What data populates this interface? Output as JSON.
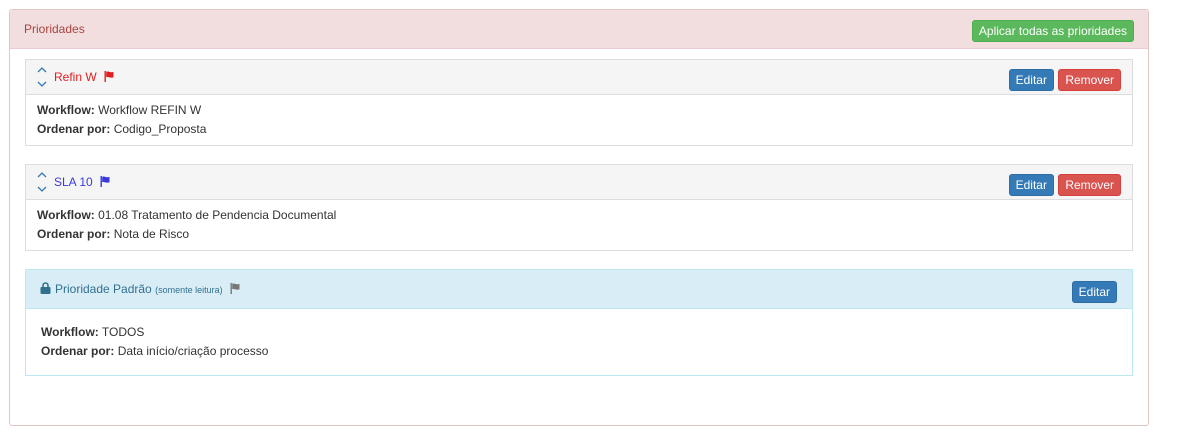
{
  "panel": {
    "title": "Prioridades",
    "apply_all_label": "Aplicar todas as prioridades"
  },
  "priorities": [
    {
      "name": "Refin W",
      "color": "#e02020",
      "flag_icon": "flag-icon",
      "edit_label": "Editar",
      "remove_label": "Remover",
      "workflow_label": "Workflow:",
      "workflow_value": "Workflow REFIN W",
      "order_label": "Ordenar por:",
      "order_value": "Codigo_Proposta"
    },
    {
      "name": "SLA 10",
      "color": "#3a3adb",
      "flag_icon": "flag-icon",
      "edit_label": "Editar",
      "remove_label": "Remover",
      "workflow_label": "Workflow:",
      "workflow_value": "01.08 Tratamento de Pendencia Documental",
      "order_label": "Ordenar por:",
      "order_value": "Nota de Risco"
    }
  ],
  "default_priority": {
    "name": "Prioridade Padrão",
    "note": "(somente leitura)",
    "lock_icon": "lock-icon",
    "flag_icon": "flag-icon",
    "edit_label": "Editar",
    "workflow_label": "Workflow:",
    "workflow_value": "TODOS",
    "order_label": "Ordenar por:",
    "order_value": "Data início/criação processo"
  },
  "colors": {
    "success": "#5cb85c",
    "primary": "#337ab7",
    "danger": "#d9534f",
    "panel_header": "#f2dede",
    "info_header": "#d9edf7"
  }
}
